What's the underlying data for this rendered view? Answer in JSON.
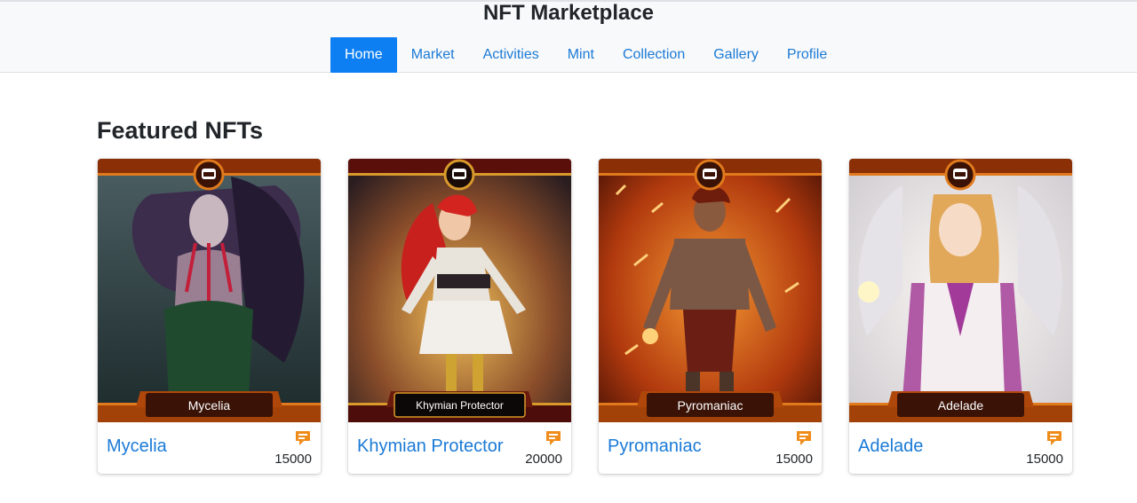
{
  "header": {
    "title": "NFT Marketplace",
    "nav": [
      {
        "label": "Home",
        "active": true
      },
      {
        "label": "Market",
        "active": false
      },
      {
        "label": "Activities",
        "active": false
      },
      {
        "label": "Mint",
        "active": false
      },
      {
        "label": "Collection",
        "active": false
      },
      {
        "label": "Gallery",
        "active": false
      },
      {
        "label": "Profile",
        "active": false
      }
    ]
  },
  "featured": {
    "heading": "Featured NFTs",
    "cards": [
      {
        "plate": "Mycelia",
        "name": "Mycelia",
        "price": "15000",
        "icon": "chat-bubble-icon"
      },
      {
        "plate": "Khymian Protector",
        "name": "Khymian Protector",
        "price": "20000",
        "icon": "chat-bubble-icon"
      },
      {
        "plate": "Pyromaniac",
        "name": "Pyromaniac",
        "price": "15000",
        "icon": "chat-bubble-icon"
      },
      {
        "plate": "Adelade",
        "name": "Adelade",
        "price": "15000",
        "icon": "chat-bubble-icon"
      }
    ]
  },
  "colors": {
    "accent": "#0d7ff2",
    "link": "#1b7ad6",
    "frame": "#b0470a",
    "plate": "#3a1206"
  }
}
